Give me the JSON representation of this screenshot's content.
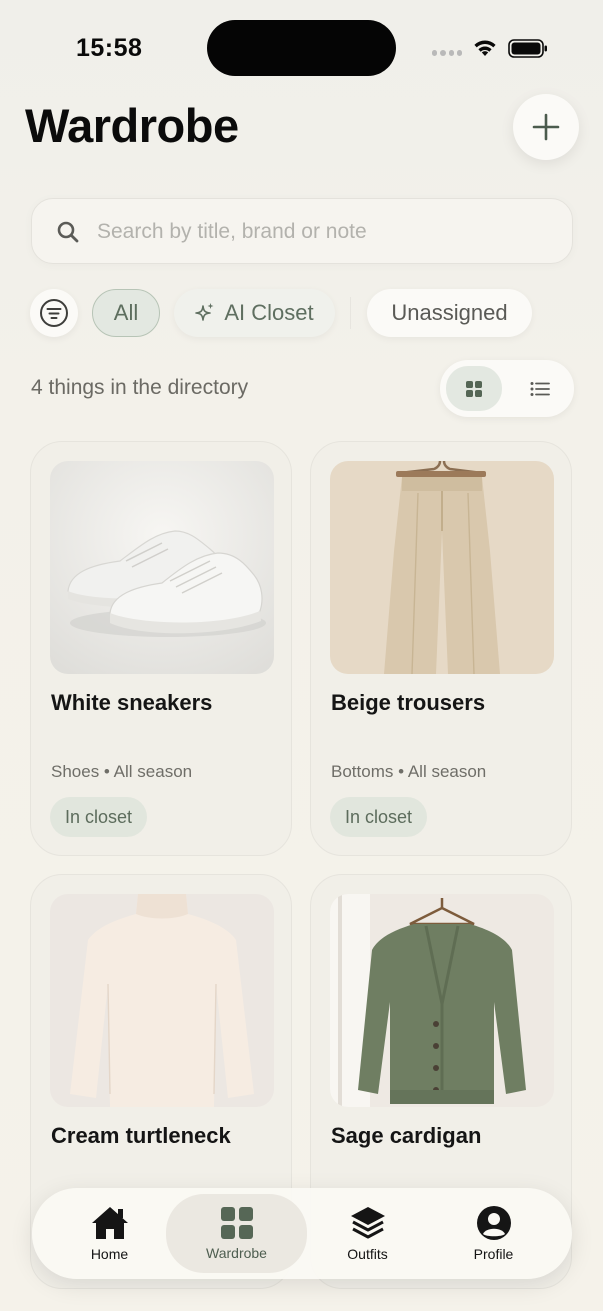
{
  "status_bar": {
    "time": "15:58"
  },
  "header": {
    "title": "Wardrobe"
  },
  "search": {
    "placeholder": "Search by title, brand or note"
  },
  "filters": {
    "chips": [
      {
        "label": "All",
        "selected": true
      },
      {
        "label": "AI Closet",
        "selected": false
      },
      {
        "label": "Unassigned",
        "selected": false
      }
    ]
  },
  "directory": {
    "count_text": "4 things in the directory",
    "view_mode": "grid"
  },
  "items": [
    {
      "title": "White sneakers",
      "category": "Shoes",
      "season": "All season",
      "status": "In closet"
    },
    {
      "title": "Beige trousers",
      "category": "Bottoms",
      "season": "All season",
      "status": "In closet"
    },
    {
      "title": "Cream turtleneck",
      "category": "",
      "season": "",
      "status": ""
    },
    {
      "title": "Sage cardigan",
      "category": "",
      "season": "",
      "status": ""
    }
  ],
  "meta_separator": " • ",
  "tab_bar": {
    "tabs": [
      {
        "label": "Home",
        "icon": "home-icon",
        "active": false
      },
      {
        "label": "Wardrobe",
        "icon": "grid-icon",
        "active": true
      },
      {
        "label": "Outfits",
        "icon": "layers-icon",
        "active": false
      },
      {
        "label": "Profile",
        "icon": "person-icon",
        "active": false
      }
    ]
  },
  "colors": {
    "accent": "#5d6e5e",
    "chip_selected_bg": "#e3e8e1",
    "badge_bg": "#e1e6dd",
    "background": "#f3f1ea"
  }
}
